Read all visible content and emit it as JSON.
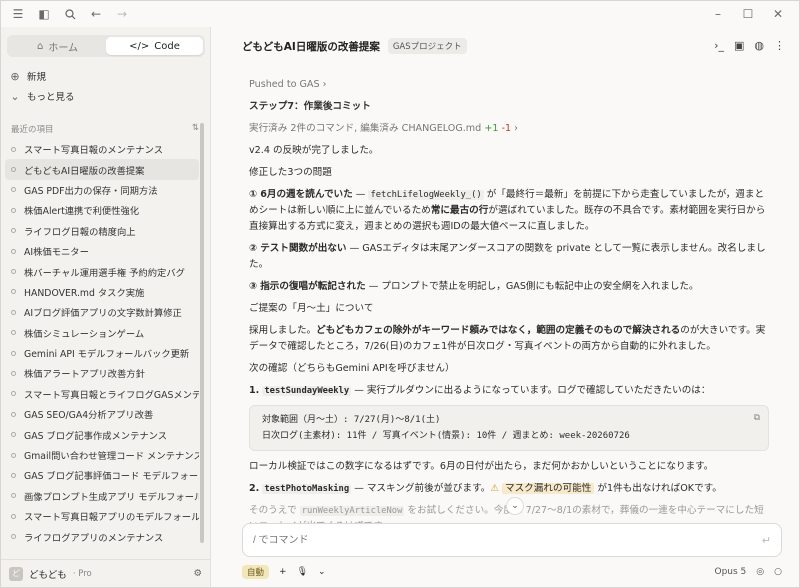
{
  "sidebar": {
    "tabs": [
      {
        "label": "ホーム",
        "icon": "home-icon"
      },
      {
        "label": "Code",
        "icon": "code-icon"
      }
    ],
    "new_label": "新規",
    "more_label": "もっと見る",
    "recent_label": "最近の項目",
    "items": [
      "スマート写真日報のメンテナンス",
      "どもどもAI日曜版の改善提案",
      "GAS PDF出力の保存・同期方法",
      "株価Alert連携で利便性強化",
      "ライフログ日報の精度向上",
      "AI株価モニター",
      "株バーチャル運用選手権 予約約定バグ",
      "HANDOVER.md タスク実施",
      "AIブログ評価アプリの文字数計算修正",
      "株価シミュレーションゲーム",
      "Gemini API モデルフォールバック更新",
      "株価アラートアプリ改善方針",
      "スマート写真日報とライフログGASメンテナ",
      "GAS SEO/GA4分析アプリ改善",
      "GAS ブログ記事作成メンテナンス",
      "Gmail問い合わせ管理コード メンテナンス",
      "GAS ブログ記事評価コード モデルフォールバ",
      "画像プロンプト生成アプリ モデルフォールバッ",
      "スマート写真日報アプリのモデルフォールバッ",
      "ライフログアプリのメンテナンス"
    ],
    "selected_index": 1,
    "user": {
      "name": "どもども",
      "plan": "· Pro",
      "avatar": "ど"
    }
  },
  "header": {
    "title": "どもどもAI日曜版の改善提案",
    "project": "GASプロジェクト"
  },
  "messages": {
    "pushed": "Pushed to GAS",
    "step7": "ステップ7：作業後コミット",
    "exec_prefix": "実行済み 2件のコマンド, 編集済み CHANGELOG.md",
    "diff_add": "+1",
    "diff_del": "-1",
    "done": "v2.4 の反映が完了しました。",
    "fixed_head": "修正した3つの問題",
    "p1_num": "①",
    "p1_bold": "6月の週を読んでいた",
    "p1_dash": " — ",
    "p1_code": "fetchLifelogWeekly_()",
    "p1_text1": " が「最終行＝最新」を前提に下から走査していましたが，週まとめシートは新しい順に上に並んでいるため",
    "p1_bold2": "常に最古の行",
    "p1_text2": "が選ばれていました。既存の不具合です。素材範囲を実行日から直接算出する方式に変え，週まとめの選択も週IDの最大値ベースに直しました。",
    "p2_num": "②",
    "p2_bold": "テスト関数が出ない",
    "p2_text": " — GASエディタは末尾アンダースコアの関数を private として一覧に表示しません。改名しました。",
    "p3_num": "③",
    "p3_bold": "指示の復唱が転記された",
    "p3_text": " — プロンプトで禁止を明記し，GAS側にも転記中止の安全網を入れました。",
    "proposal_head": "ご提案の「月〜土」について",
    "proposal_text1": "採用しました。",
    "proposal_bold": "どもどもカフェの除外がキーワード頼みではなく，範囲の定義そのもので解決される",
    "proposal_text2": "のが大きいです。実データで確認したところ，7/26(日)のカフェ1件が日次ログ・写真イベントの両方から自動的に外れました。",
    "next_head": "次の確認（どちらもGemini APIを呼びません）",
    "n1_num": "1.",
    "n1_code": "testSundayWeekly",
    "n1_text": " — 実行プルダウンに出るようになっています。ログで確認していただきたいのは：",
    "codeblock": [
      "対象範囲（月〜土）: 7/27(月)〜8/1(土)",
      "日次ログ(主素材): 11件 / 写真イベント(情景): 10件 / 週まとめ: week-20260726"
    ],
    "after_code": "ローカル検証ではこの数字になるはずです。6月の日付が出たら，まだ何かおかしいということになります。",
    "n2_num": "2.",
    "n2_code": "testPhotoMasking",
    "n2_text1": " — マスキング前後が並びます。",
    "n2_warn_icon": "⚠",
    "n2_warn": "マスク漏れの可能性",
    "n2_text2": " が1件も出なければOKです。",
    "fade_text1": "そのうえで ",
    "fade_code": "runWeeklyArticleNow",
    "fade_text2": " をお試しください。今度は 7/27〜8/1の素材で，葬儀の一連を中心テーマにした短いエッセイが出てくるはずです。"
  },
  "composer": {
    "placeholder": "/ でコマンド",
    "mode": "自動",
    "model": "Opus 5"
  }
}
